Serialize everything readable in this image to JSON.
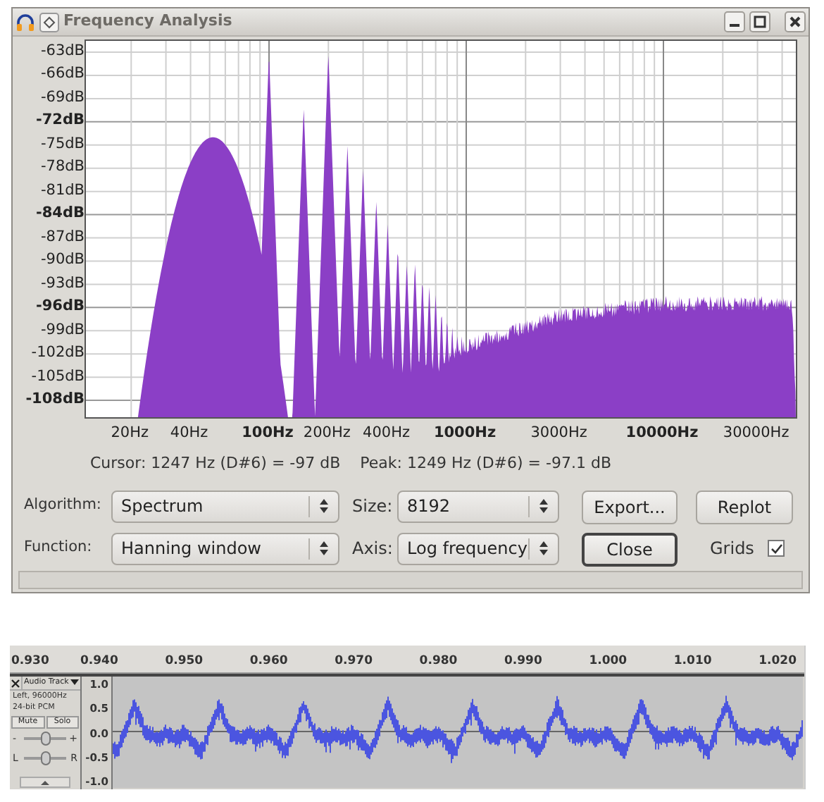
{
  "window": {
    "title": "Frequency Analysis"
  },
  "plot": {
    "y_labels": [
      {
        "text": "-63dB",
        "major": false
      },
      {
        "text": "-66dB",
        "major": false
      },
      {
        "text": "-69dB",
        "major": false
      },
      {
        "text": "-72dB",
        "major": true
      },
      {
        "text": "-75dB",
        "major": false
      },
      {
        "text": "-78dB",
        "major": false
      },
      {
        "text": "-81dB",
        "major": false
      },
      {
        "text": "-84dB",
        "major": true
      },
      {
        "text": "-87dB",
        "major": false
      },
      {
        "text": "-90dB",
        "major": false
      },
      {
        "text": "-93dB",
        "major": false
      },
      {
        "text": "-96dB",
        "major": true
      },
      {
        "text": "-99dB",
        "major": false
      },
      {
        "text": "-102dB",
        "major": false
      },
      {
        "text": "-105dB",
        "major": false
      },
      {
        "text": "-108dB",
        "major": true
      }
    ],
    "x_labels": [
      {
        "text": "20Hz",
        "major": false
      },
      {
        "text": "40Hz",
        "major": false
      },
      {
        "text": "100Hz",
        "major": true
      },
      {
        "text": "200Hz",
        "major": false
      },
      {
        "text": "400Hz",
        "major": false
      },
      {
        "text": "1000Hz",
        "major": true
      },
      {
        "text": "3000Hz",
        "major": false
      },
      {
        "text": "10000Hz",
        "major": true
      },
      {
        "text": "30000Hz",
        "major": false
      }
    ]
  },
  "readout": {
    "cursor": "Cursor: 1247 Hz (D#6) = -97 dB",
    "peak": "Peak: 1249 Hz (D#6) = -97.1 dB"
  },
  "fields": [
    {
      "label": "Algorithm:",
      "value": "Spectrum"
    },
    {
      "label": "Size:",
      "value": "8192"
    },
    {
      "label": "Function:",
      "value": "Hanning window"
    },
    {
      "label": "Axis:",
      "value": "Log frequency"
    }
  ],
  "buttons": [
    {
      "label": "Export...",
      "default": false
    },
    {
      "label": "Replot",
      "default": false
    },
    {
      "label": "Close",
      "default": true
    }
  ],
  "grids": {
    "label": "Grids",
    "checked": true
  },
  "ruler": [
    "0.930",
    "0.940",
    "0.950",
    "0.960",
    "0.970",
    "0.980",
    "0.990",
    "1.000",
    "1.010",
    "1.020"
  ],
  "track": {
    "name": "Audio Track",
    "info": [
      "Left, 96000Hz",
      "24-bit PCM"
    ],
    "buttons": [
      "Mute",
      "Solo"
    ],
    "gain": {
      "min": "-",
      "max": "+",
      "level": 0.5
    },
    "pan": {
      "min": "L",
      "max": "R",
      "level": 0.5
    },
    "scale": [
      "1.0",
      "0.5",
      "0.0",
      "-0.5",
      "-1.0"
    ]
  }
}
